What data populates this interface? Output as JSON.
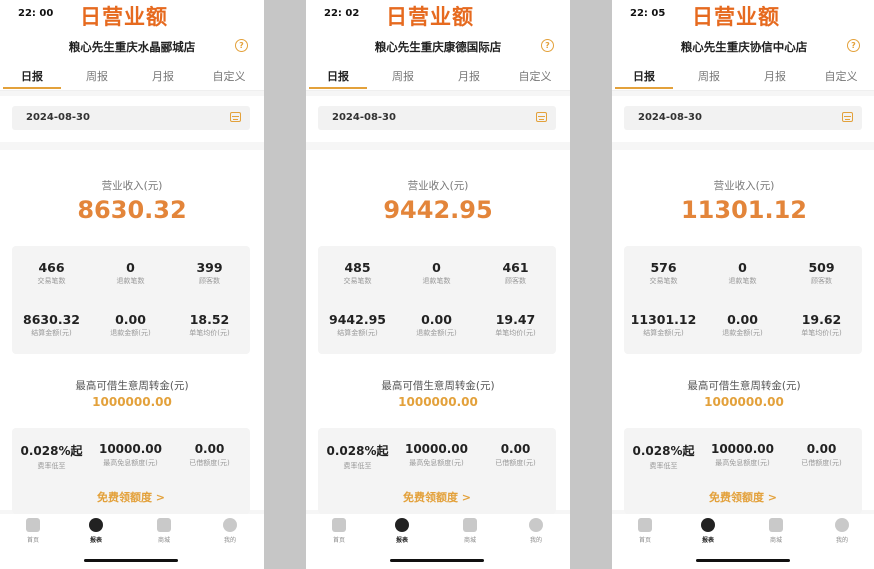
{
  "tabs": [
    "日报",
    "周报",
    "月报",
    "自定义"
  ],
  "labels": {
    "revenue": "营业收入(元)",
    "trade_count": "交易笔数",
    "refund_count": "退款笔数",
    "customer_count": "顾客数",
    "settle_amount": "结算金额(元)",
    "refund_amount": "退款金额(元)",
    "avg_per_order": "单笔均价(元)",
    "capital_label": "最高可借生意周转金(元)",
    "rate_label": "费率低至",
    "limit_label": "最高免息额度(元)",
    "used_label": "已借额度(元)",
    "free_btn": "免费领额度 >"
  },
  "nav": [
    "首页",
    "报表",
    "商城",
    "我的"
  ],
  "colors": {
    "accent": "#e3a13b",
    "title": "#e66a1f",
    "revenue": "#e3853a"
  },
  "screens": [
    {
      "time": "22: 00",
      "title": "日营业额",
      "store": "粮心先生重庆水晶郦城店",
      "date": "2024-08-30",
      "revenue": "8630.32",
      "trade_count": "466",
      "refund_count": "0",
      "customer_count": "399",
      "settle_amount": "8630.32",
      "refund_amount": "0.00",
      "avg_per_order": "18.52",
      "capital": "1000000.00",
      "rate": "0.028%起",
      "limit": "10000.00",
      "used": "0.00"
    },
    {
      "time": "22: 02",
      "title": "日营业额",
      "store": "粮心先生重庆康德国际店",
      "date": "2024-08-30",
      "revenue": "9442.95",
      "trade_count": "485",
      "refund_count": "0",
      "customer_count": "461",
      "settle_amount": "9442.95",
      "refund_amount": "0.00",
      "avg_per_order": "19.47",
      "capital": "1000000.00",
      "rate": "0.028%起",
      "limit": "10000.00",
      "used": "0.00"
    },
    {
      "time": "22: 05",
      "title": "日营业额",
      "store": "粮心先生重庆协信中心店",
      "date": "2024-08-30",
      "revenue": "11301.12",
      "trade_count": "576",
      "refund_count": "0",
      "customer_count": "509",
      "settle_amount": "11301.12",
      "refund_amount": "0.00",
      "avg_per_order": "19.62",
      "capital": "1000000.00",
      "rate": "0.028%起",
      "limit": "10000.00",
      "used": "0.00"
    }
  ]
}
